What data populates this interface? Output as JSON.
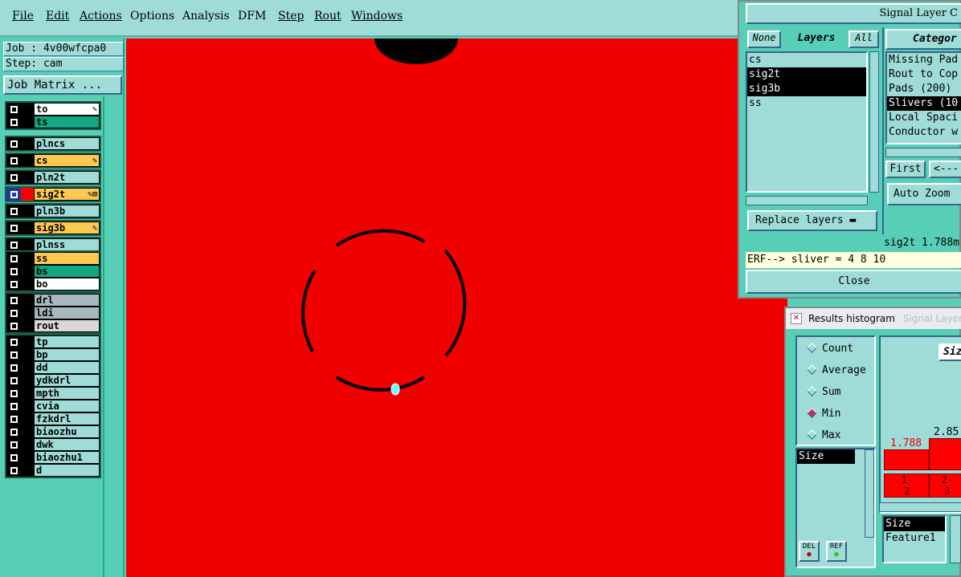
{
  "menubar": {
    "items": [
      "File",
      "Edit",
      "Actions",
      "Options",
      "Analysis",
      "DFM",
      "Step",
      "Rout",
      "Windows"
    ]
  },
  "left": {
    "job": "Job : 4v00wfcpa0",
    "step": "Step: cam",
    "job_matrix": "Job Matrix ...",
    "layers": [
      {
        "name": "to",
        "bg": "#ffffff",
        "pen": "✎"
      },
      {
        "name": "ts",
        "bg": "#12a882",
        "pen": ""
      },
      {
        "name": "plncs",
        "bg": "#9fdcd8",
        "pen": ""
      },
      {
        "name": "cs",
        "bg": "#ffc850",
        "pen": "✎"
      },
      {
        "name": "pln2t",
        "bg": "#9fdcd8",
        "pen": ""
      },
      {
        "name": "sig2t",
        "bg": "#ffc850",
        "pen": "✎⊞"
      },
      {
        "name": "pln3b",
        "bg": "#9fdcd8",
        "pen": ""
      },
      {
        "name": "sig3b",
        "bg": "#ffc850",
        "pen": "✎"
      },
      {
        "name": "plnss",
        "bg": "#9fdcd8",
        "pen": ""
      },
      {
        "name": "ss",
        "bg": "#ffc850",
        "pen": ""
      },
      {
        "name": "bs",
        "bg": "#12a882",
        "pen": ""
      },
      {
        "name": "bo",
        "bg": "#ffffff",
        "pen": ""
      },
      {
        "name": "drl",
        "bg": "#a8b8c0",
        "pen": ""
      },
      {
        "name": "ldi",
        "bg": "#a8b8c0",
        "pen": ""
      },
      {
        "name": "rout",
        "bg": "#d8d8d8",
        "pen": ""
      },
      {
        "name": "tp",
        "bg": "#9fdcd8",
        "pen": ""
      },
      {
        "name": "bp",
        "bg": "#9fdcd8",
        "pen": ""
      },
      {
        "name": "dd",
        "bg": "#9fdcd8",
        "pen": ""
      },
      {
        "name": "ydkdrl",
        "bg": "#9fdcd8",
        "pen": ""
      },
      {
        "name": "mpth",
        "bg": "#9fdcd8",
        "pen": ""
      },
      {
        "name": "cvia",
        "bg": "#9fdcd8",
        "pen": ""
      },
      {
        "name": "fzkdrl",
        "bg": "#9fdcd8",
        "pen": ""
      },
      {
        "name": "biaozhu",
        "bg": "#9fdcd8",
        "pen": ""
      },
      {
        "name": "dwk",
        "bg": "#9fdcd8",
        "pen": ""
      },
      {
        "name": "biaozhu1",
        "bg": "#9fdcd8",
        "pen": ""
      },
      {
        "name": "d",
        "bg": "#9fdcd8",
        "pen": ""
      }
    ]
  },
  "signal_window": {
    "title": "Signal Layer C",
    "none_btn": "None",
    "layers_label": "Layers",
    "all_btn": "All",
    "layer_list": [
      "cs",
      "sig2t",
      "sig3b",
      "ss"
    ],
    "category_header": "Categor",
    "categories": [
      "Missing Pad",
      "Rout to Cop",
      "Pads (200)",
      "Slivers (10",
      "Local Spaci",
      "Conductor w"
    ],
    "first_btn": "First",
    "prev_btn": "<---",
    "auto_zoom": "Auto Zoom",
    "replace_layers": "Replace layers",
    "status": "sig2t 1.788m",
    "erf": "ERF--> sliver = 4 8 10",
    "close": "Close"
  },
  "histogram": {
    "title": "Results histogram",
    "ghost_title": "Signal Layer",
    "radios": [
      {
        "label": "Count",
        "on": false
      },
      {
        "label": "Average",
        "on": false
      },
      {
        "label": "Sum",
        "on": false
      },
      {
        "label": "Min",
        "on": true
      },
      {
        "label": "Max",
        "on": false
      }
    ],
    "size_list": [
      "Size"
    ],
    "del_btn": "DEL",
    "ref_btn": "REF",
    "size_tab": "Siz",
    "bar_value_1": "1.788",
    "bar_value_2": "2.85",
    "bin_1": "1-\n2",
    "bin_2": "2-\n3",
    "attr_list": [
      "Size",
      "Feature1"
    ]
  }
}
